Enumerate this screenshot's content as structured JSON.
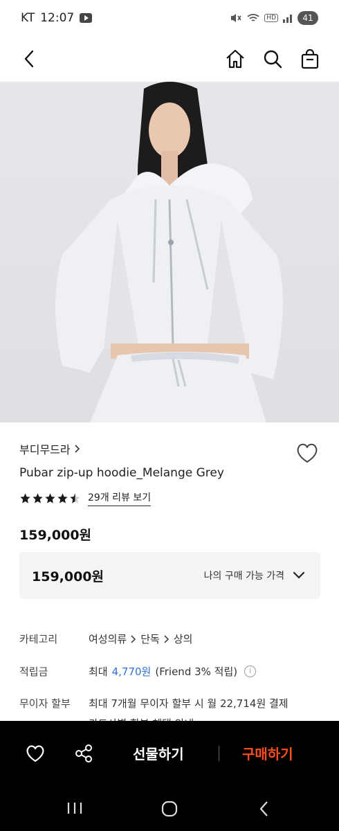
{
  "status_bar": {
    "carrier": "KT",
    "time": "12:07",
    "battery": "41",
    "hd": "HD"
  },
  "nav": {
    "back_icon": "chevron-left-icon",
    "home_icon": "home-icon",
    "search_icon": "search-icon",
    "bag_icon": "shopping-bag-icon"
  },
  "product": {
    "brand": "부디무드라",
    "name": "Pubar zip-up hoodie_Melange Grey",
    "rating_stars": 4.5,
    "review_link": "29개 리뷰 보기",
    "price": "159,000원"
  },
  "price_box": {
    "value": "159,000원",
    "label": "나의 구매 가능 가격"
  },
  "info": {
    "category_label": "카테고리",
    "category_path": [
      "여성의류",
      "단독",
      "상의"
    ],
    "points_label": "적립금",
    "points_prefix": "최대",
    "points_value": "4,770원",
    "points_suffix": "(Friend 3% 적립)",
    "installment_label": "무이자 할부",
    "installment_text": "최대 7개월 무이자 할부 시 월 22,714원 결제",
    "installment_sub": "카드사별 할부 혜택 안내"
  },
  "action_bar": {
    "gift_label": "선물하기",
    "buy_label": "구매하기"
  },
  "colors": {
    "accent_buy": "#ff4d1f",
    "points_blue": "#2f6fd6"
  }
}
